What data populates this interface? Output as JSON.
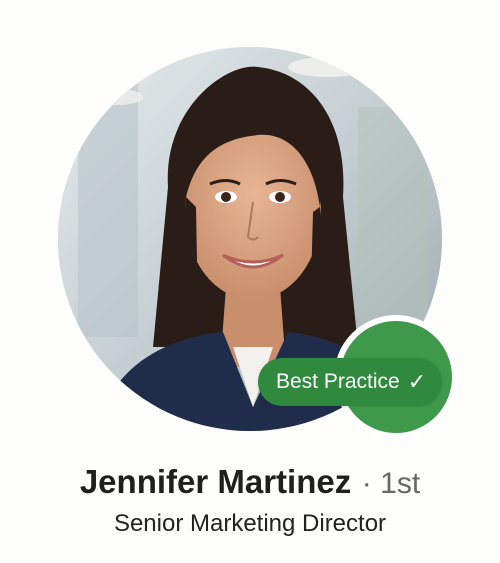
{
  "profile": {
    "name": "Jennifer Martinez",
    "separator": "·",
    "connection_degree": "1st",
    "headline": "Senior Marketing Director"
  },
  "badge": {
    "label": "Best Practice",
    "check_glyph": "✓",
    "icon": "check-icon",
    "color": "#2f8a3e"
  },
  "colors": {
    "badge_green": "#3e9a4a",
    "name_text": "#1f1f1f",
    "muted_text": "#666666"
  }
}
